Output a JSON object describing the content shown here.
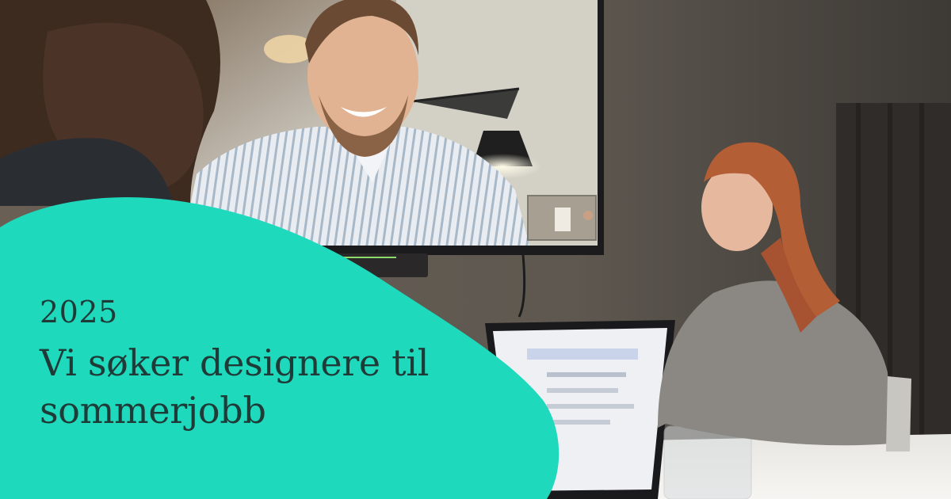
{
  "banner": {
    "year": "2025",
    "headline_line1": "Vi søker designere til",
    "headline_line2": "sommerjobb"
  },
  "colors": {
    "blob": "#1fd9bd",
    "text": "#1e3b38",
    "wall": "#5b554e"
  },
  "photo": {
    "description_icons": [
      "person-on-video-call",
      "woman-at-laptop",
      "person-foreground"
    ]
  }
}
